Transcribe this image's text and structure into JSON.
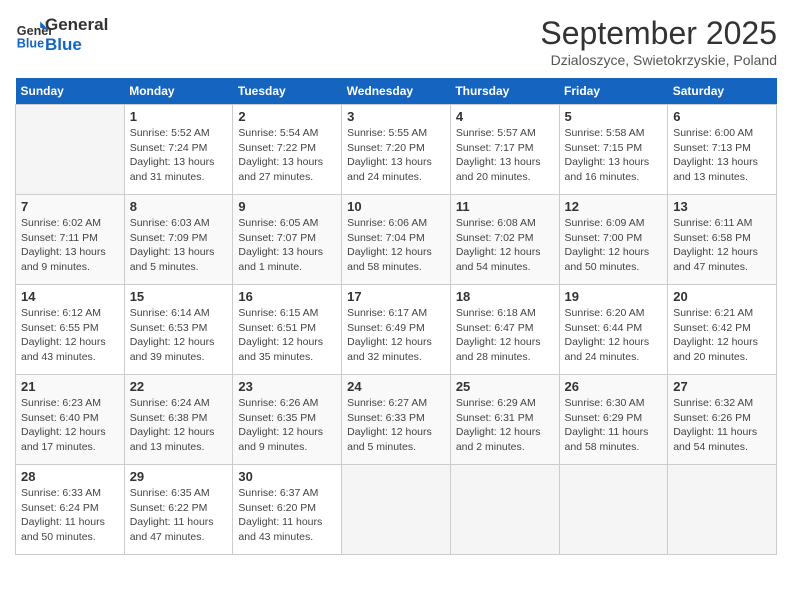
{
  "header": {
    "logo_general": "General",
    "logo_blue": "Blue",
    "month_title": "September 2025",
    "location": "Dzialoszyce, Swietokrzyskie, Poland"
  },
  "days_of_week": [
    "Sunday",
    "Monday",
    "Tuesday",
    "Wednesday",
    "Thursday",
    "Friday",
    "Saturday"
  ],
  "weeks": [
    [
      {
        "day": "",
        "info": ""
      },
      {
        "day": "1",
        "info": "Sunrise: 5:52 AM\nSunset: 7:24 PM\nDaylight: 13 hours\nand 31 minutes."
      },
      {
        "day": "2",
        "info": "Sunrise: 5:54 AM\nSunset: 7:22 PM\nDaylight: 13 hours\nand 27 minutes."
      },
      {
        "day": "3",
        "info": "Sunrise: 5:55 AM\nSunset: 7:20 PM\nDaylight: 13 hours\nand 24 minutes."
      },
      {
        "day": "4",
        "info": "Sunrise: 5:57 AM\nSunset: 7:17 PM\nDaylight: 13 hours\nand 20 minutes."
      },
      {
        "day": "5",
        "info": "Sunrise: 5:58 AM\nSunset: 7:15 PM\nDaylight: 13 hours\nand 16 minutes."
      },
      {
        "day": "6",
        "info": "Sunrise: 6:00 AM\nSunset: 7:13 PM\nDaylight: 13 hours\nand 13 minutes."
      }
    ],
    [
      {
        "day": "7",
        "info": "Sunrise: 6:02 AM\nSunset: 7:11 PM\nDaylight: 13 hours\nand 9 minutes."
      },
      {
        "day": "8",
        "info": "Sunrise: 6:03 AM\nSunset: 7:09 PM\nDaylight: 13 hours\nand 5 minutes."
      },
      {
        "day": "9",
        "info": "Sunrise: 6:05 AM\nSunset: 7:07 PM\nDaylight: 13 hours\nand 1 minute."
      },
      {
        "day": "10",
        "info": "Sunrise: 6:06 AM\nSunset: 7:04 PM\nDaylight: 12 hours\nand 58 minutes."
      },
      {
        "day": "11",
        "info": "Sunrise: 6:08 AM\nSunset: 7:02 PM\nDaylight: 12 hours\nand 54 minutes."
      },
      {
        "day": "12",
        "info": "Sunrise: 6:09 AM\nSunset: 7:00 PM\nDaylight: 12 hours\nand 50 minutes."
      },
      {
        "day": "13",
        "info": "Sunrise: 6:11 AM\nSunset: 6:58 PM\nDaylight: 12 hours\nand 47 minutes."
      }
    ],
    [
      {
        "day": "14",
        "info": "Sunrise: 6:12 AM\nSunset: 6:55 PM\nDaylight: 12 hours\nand 43 minutes."
      },
      {
        "day": "15",
        "info": "Sunrise: 6:14 AM\nSunset: 6:53 PM\nDaylight: 12 hours\nand 39 minutes."
      },
      {
        "day": "16",
        "info": "Sunrise: 6:15 AM\nSunset: 6:51 PM\nDaylight: 12 hours\nand 35 minutes."
      },
      {
        "day": "17",
        "info": "Sunrise: 6:17 AM\nSunset: 6:49 PM\nDaylight: 12 hours\nand 32 minutes."
      },
      {
        "day": "18",
        "info": "Sunrise: 6:18 AM\nSunset: 6:47 PM\nDaylight: 12 hours\nand 28 minutes."
      },
      {
        "day": "19",
        "info": "Sunrise: 6:20 AM\nSunset: 6:44 PM\nDaylight: 12 hours\nand 24 minutes."
      },
      {
        "day": "20",
        "info": "Sunrise: 6:21 AM\nSunset: 6:42 PM\nDaylight: 12 hours\nand 20 minutes."
      }
    ],
    [
      {
        "day": "21",
        "info": "Sunrise: 6:23 AM\nSunset: 6:40 PM\nDaylight: 12 hours\nand 17 minutes."
      },
      {
        "day": "22",
        "info": "Sunrise: 6:24 AM\nSunset: 6:38 PM\nDaylight: 12 hours\nand 13 minutes."
      },
      {
        "day": "23",
        "info": "Sunrise: 6:26 AM\nSunset: 6:35 PM\nDaylight: 12 hours\nand 9 minutes."
      },
      {
        "day": "24",
        "info": "Sunrise: 6:27 AM\nSunset: 6:33 PM\nDaylight: 12 hours\nand 5 minutes."
      },
      {
        "day": "25",
        "info": "Sunrise: 6:29 AM\nSunset: 6:31 PM\nDaylight: 12 hours\nand 2 minutes."
      },
      {
        "day": "26",
        "info": "Sunrise: 6:30 AM\nSunset: 6:29 PM\nDaylight: 11 hours\nand 58 minutes."
      },
      {
        "day": "27",
        "info": "Sunrise: 6:32 AM\nSunset: 6:26 PM\nDaylight: 11 hours\nand 54 minutes."
      }
    ],
    [
      {
        "day": "28",
        "info": "Sunrise: 6:33 AM\nSunset: 6:24 PM\nDaylight: 11 hours\nand 50 minutes."
      },
      {
        "day": "29",
        "info": "Sunrise: 6:35 AM\nSunset: 6:22 PM\nDaylight: 11 hours\nand 47 minutes."
      },
      {
        "day": "30",
        "info": "Sunrise: 6:37 AM\nSunset: 6:20 PM\nDaylight: 11 hours\nand 43 minutes."
      },
      {
        "day": "",
        "info": ""
      },
      {
        "day": "",
        "info": ""
      },
      {
        "day": "",
        "info": ""
      },
      {
        "day": "",
        "info": ""
      }
    ]
  ]
}
